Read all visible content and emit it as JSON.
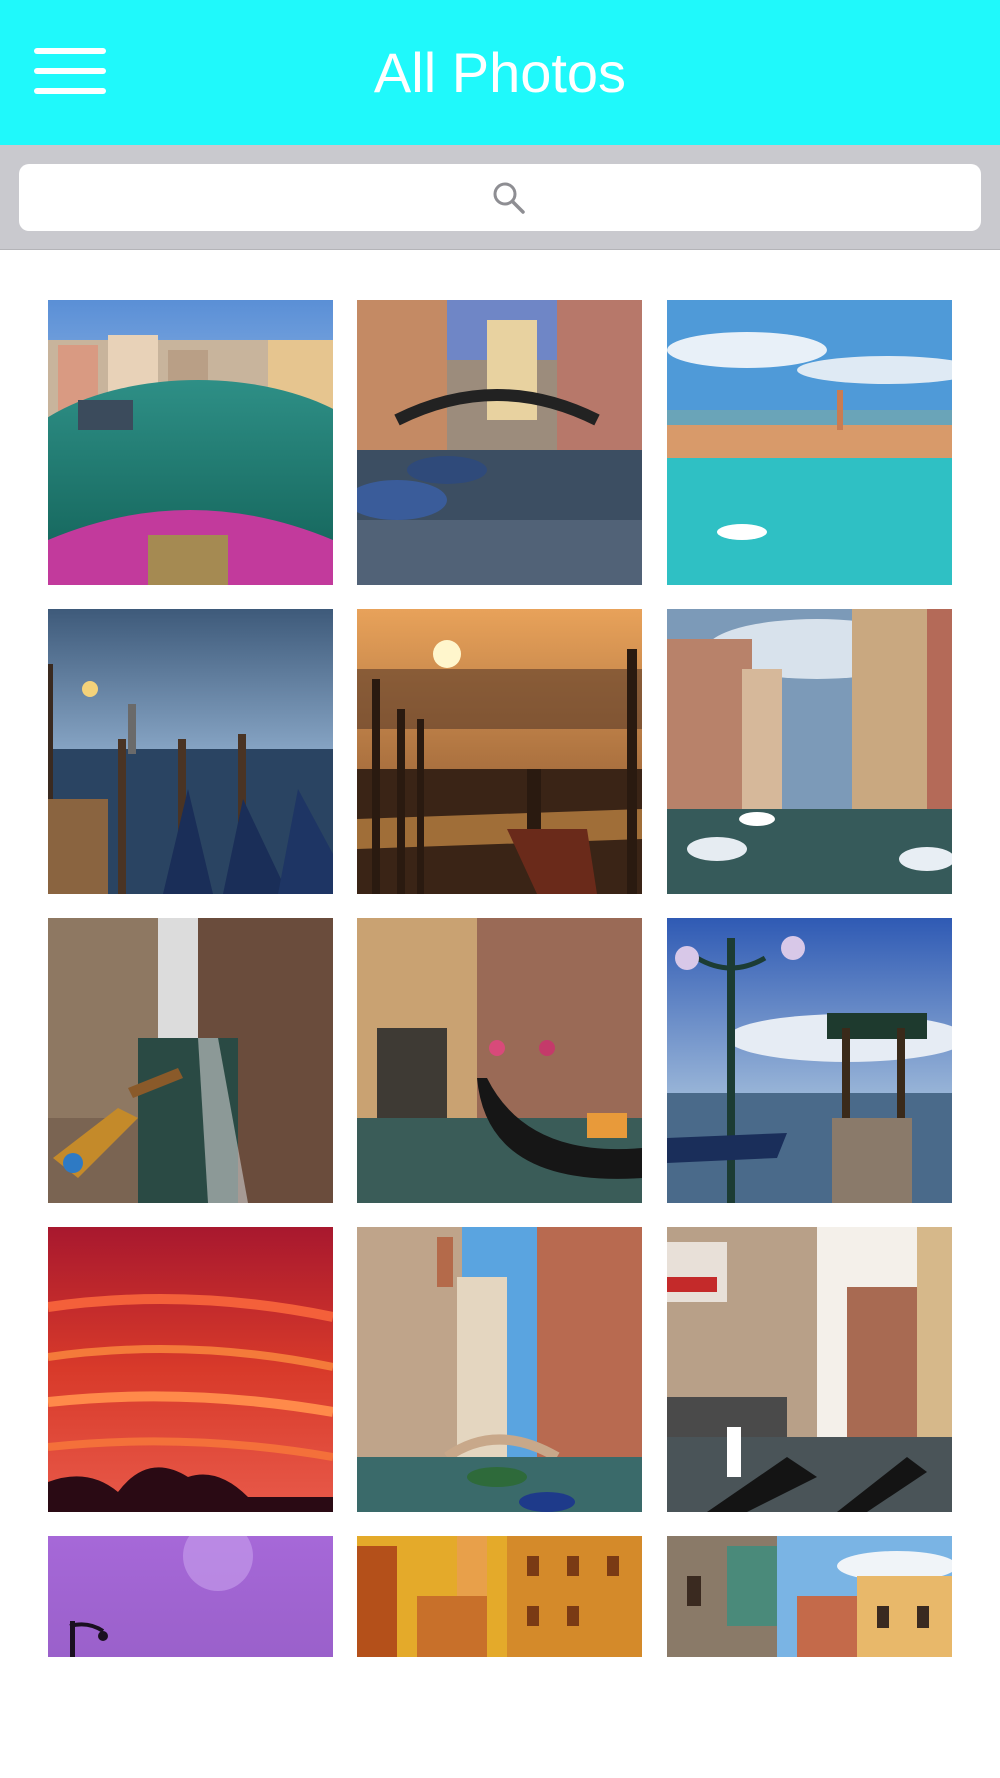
{
  "header": {
    "title": "All Photos",
    "background_color": "#1ff9fb",
    "menu_icon": "hamburger-menu-icon"
  },
  "search": {
    "placeholder": "",
    "icon": "search-icon"
  },
  "photos": [
    {
      "subject": "grand-canal-fisheye"
    },
    {
      "subject": "canal-iron-bridge"
    },
    {
      "subject": "city-aerial-lagoon"
    },
    {
      "subject": "lagoon-lamp-gondolas-dusk"
    },
    {
      "subject": "gondola-sunset"
    },
    {
      "subject": "canal-boats-buildings"
    },
    {
      "subject": "narrow-canal-reflection"
    },
    {
      "subject": "gondola-flower-balconies"
    },
    {
      "subject": "gondola-station-lamp"
    },
    {
      "subject": "red-sunset-sky-palms"
    },
    {
      "subject": "canal-bridge-buildings"
    },
    {
      "subject": "gondolier-canal"
    },
    {
      "subject": "purple-sky-lamp"
    },
    {
      "subject": "golden-buildings"
    },
    {
      "subject": "rooftops-blue-sky"
    }
  ]
}
